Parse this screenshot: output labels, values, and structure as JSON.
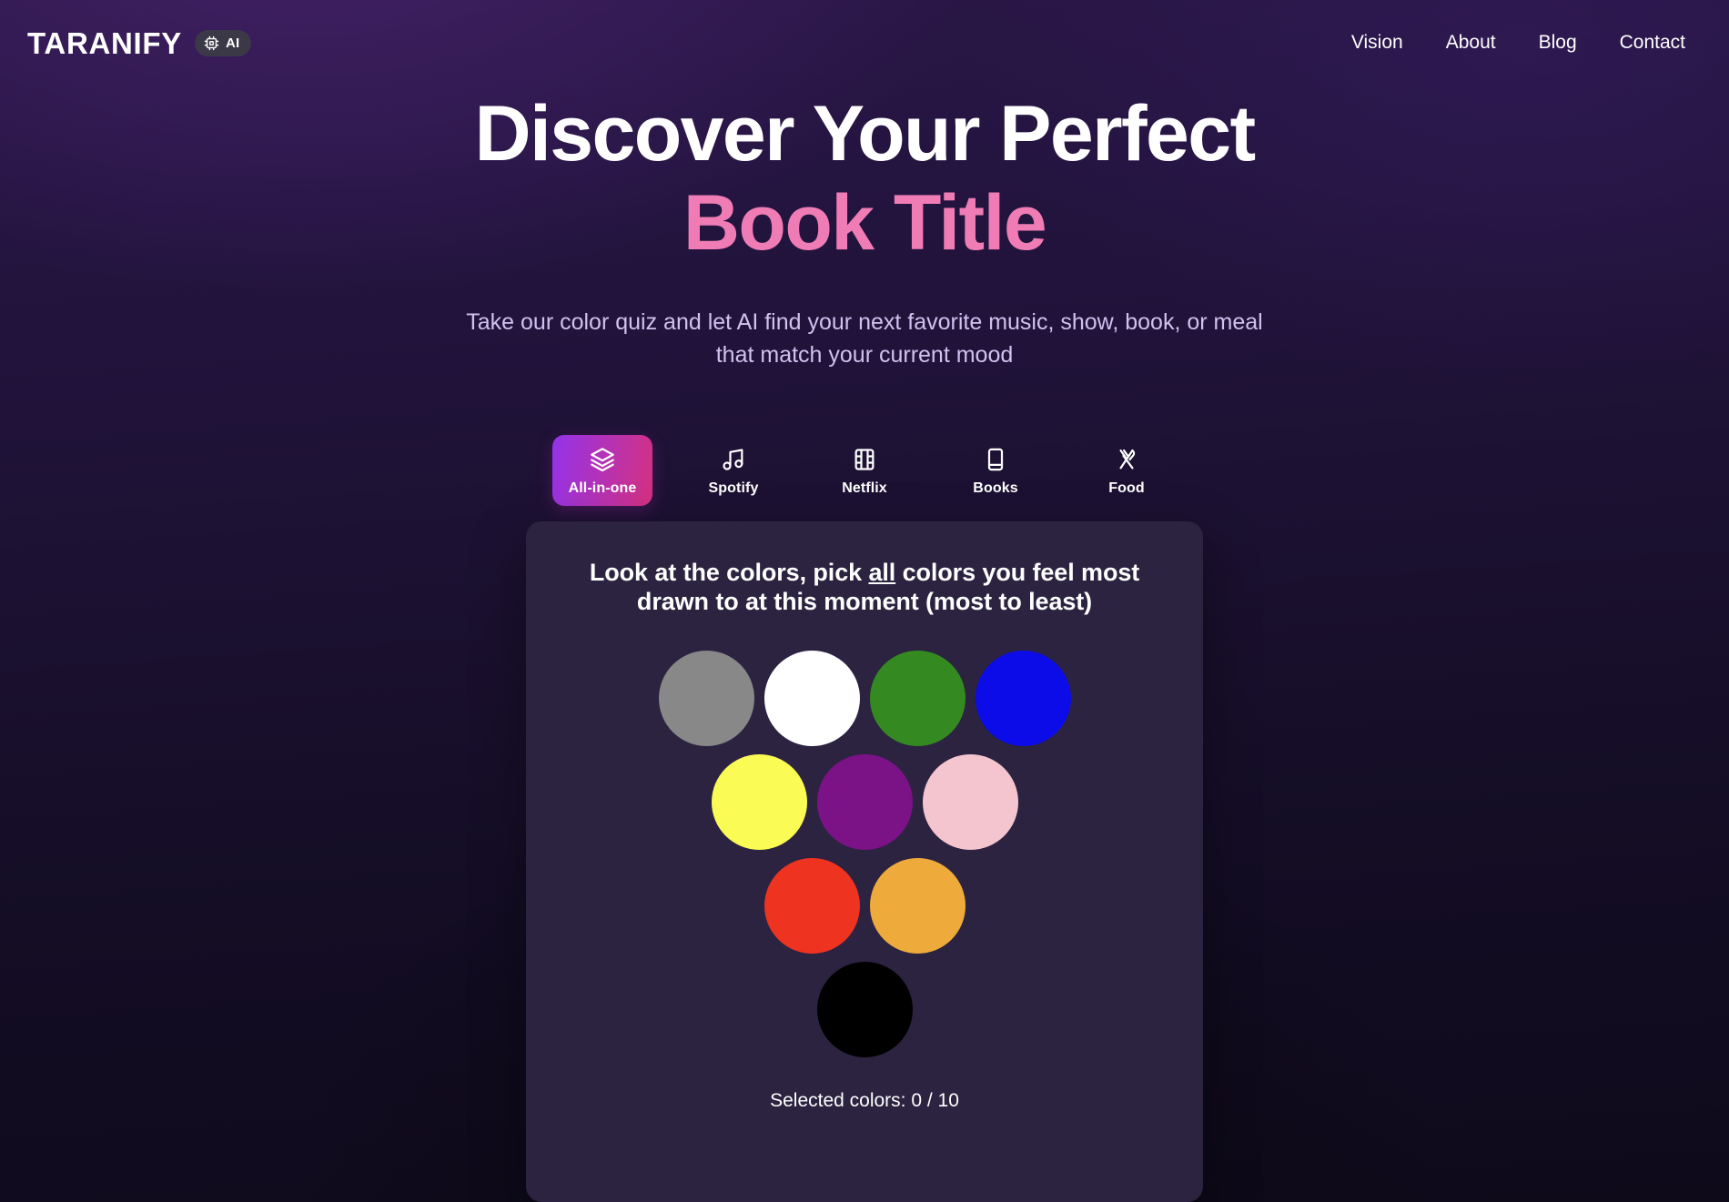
{
  "header": {
    "brand_name": "TARANIFY",
    "ai_badge_label": "AI",
    "ai_badge_icon": "cpu-chip-icon",
    "nav": [
      {
        "label": "Vision",
        "name": "nav-link-vision"
      },
      {
        "label": "About",
        "name": "nav-link-about"
      },
      {
        "label": "Blog",
        "name": "nav-link-blog"
      },
      {
        "label": "Contact",
        "name": "nav-link-contact"
      }
    ]
  },
  "hero": {
    "title_line1": "Discover Your Perfect",
    "title_line2": "Book Title",
    "title_line2_color": "#ef7cb4",
    "subtitle": "Take our color quiz and let AI find your next favorite music, show, book, or meal that match your current mood"
  },
  "tabs": {
    "active_index": 0,
    "active_gradient_from": "#9333ea",
    "active_gradient_to": "#d6317f",
    "items": [
      {
        "label": "All-in-one",
        "icon": "layers-icon",
        "active": true
      },
      {
        "label": "Spotify",
        "icon": "music-note-icon",
        "active": false
      },
      {
        "label": "Netflix",
        "icon": "film-strip-icon",
        "active": false
      },
      {
        "label": "Books",
        "icon": "book-icon",
        "active": false
      },
      {
        "label": "Food",
        "icon": "fork-knife-icon",
        "active": false
      }
    ]
  },
  "quiz": {
    "prompt_before": "Look at the colors, pick ",
    "prompt_emphasis": "all",
    "prompt_after": " colors you feel most drawn to at this moment (most to least)",
    "card_background": "#2b2340",
    "selected_label": "Selected colors: 0 / 10",
    "selected_current": 0,
    "selected_total": 10,
    "swatch_rows": [
      [
        {
          "name": "swatch-gray",
          "hex": "#888888"
        },
        {
          "name": "swatch-white",
          "hex": "#ffffff"
        },
        {
          "name": "swatch-green",
          "hex": "#348a20"
        },
        {
          "name": "swatch-blue",
          "hex": "#0c0ce8"
        }
      ],
      [
        {
          "name": "swatch-yellow",
          "hex": "#fbfb55"
        },
        {
          "name": "swatch-purple",
          "hex": "#7b1387"
        },
        {
          "name": "swatch-pink",
          "hex": "#f5c5cf"
        }
      ],
      [
        {
          "name": "swatch-red",
          "hex": "#ee3320"
        },
        {
          "name": "swatch-orange",
          "hex": "#eeab3b"
        }
      ],
      [
        {
          "name": "swatch-black",
          "hex": "#000000"
        }
      ]
    ]
  }
}
